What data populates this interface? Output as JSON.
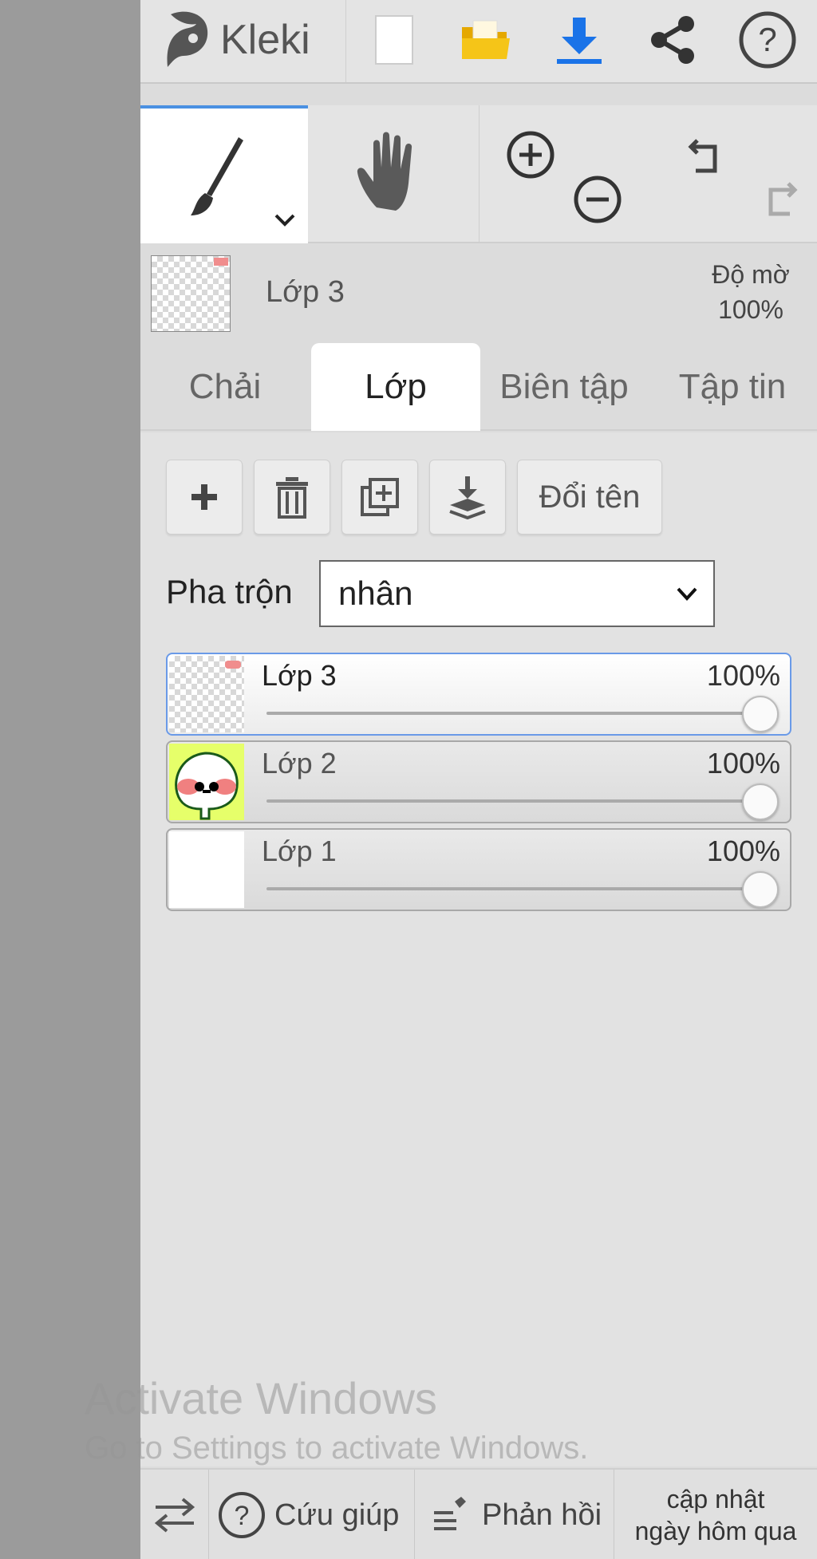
{
  "app": {
    "name": "Kleki"
  },
  "header": {
    "icons": [
      "kleki-logo-icon",
      "new-file-icon",
      "open-folder-icon",
      "download-icon",
      "share-icon",
      "help-icon"
    ]
  },
  "tools": {
    "active": "brush",
    "icons": [
      "brush-icon",
      "hand-icon",
      "zoom-in-icon",
      "zoom-out-icon",
      "undo-icon",
      "redo-icon"
    ]
  },
  "current_layer": {
    "name": "Lớp 3",
    "opacity_label": "Độ mờ",
    "opacity_value": "100%"
  },
  "tabs": [
    {
      "label": "Chải",
      "active": false
    },
    {
      "label": "Lớp",
      "active": true
    },
    {
      "label": "Biên tập",
      "active": false
    },
    {
      "label": "Tập tin",
      "active": false
    }
  ],
  "layer_panel": {
    "buttons": {
      "rename_label": "Đổi tên"
    },
    "blend": {
      "label": "Pha trộn",
      "value": "nhân"
    },
    "layers": [
      {
        "name": "Lớp 3",
        "opacity": "100%",
        "selected": true
      },
      {
        "name": "Lớp 2",
        "opacity": "100%",
        "selected": false
      },
      {
        "name": "Lớp 1",
        "opacity": "100%",
        "selected": false
      }
    ]
  },
  "watermark": {
    "title": "Activate Windows",
    "subtitle": "Go to Settings to activate Windows."
  },
  "footer": {
    "help_label": "Cứu giúp",
    "feedback_label": "Phản hồi",
    "update_line1": "cập nhật",
    "update_line2": "ngày hôm qua"
  },
  "colors": {
    "accent": "#4a90e2",
    "download": "#1a73e8",
    "folder": "#f5c518"
  }
}
